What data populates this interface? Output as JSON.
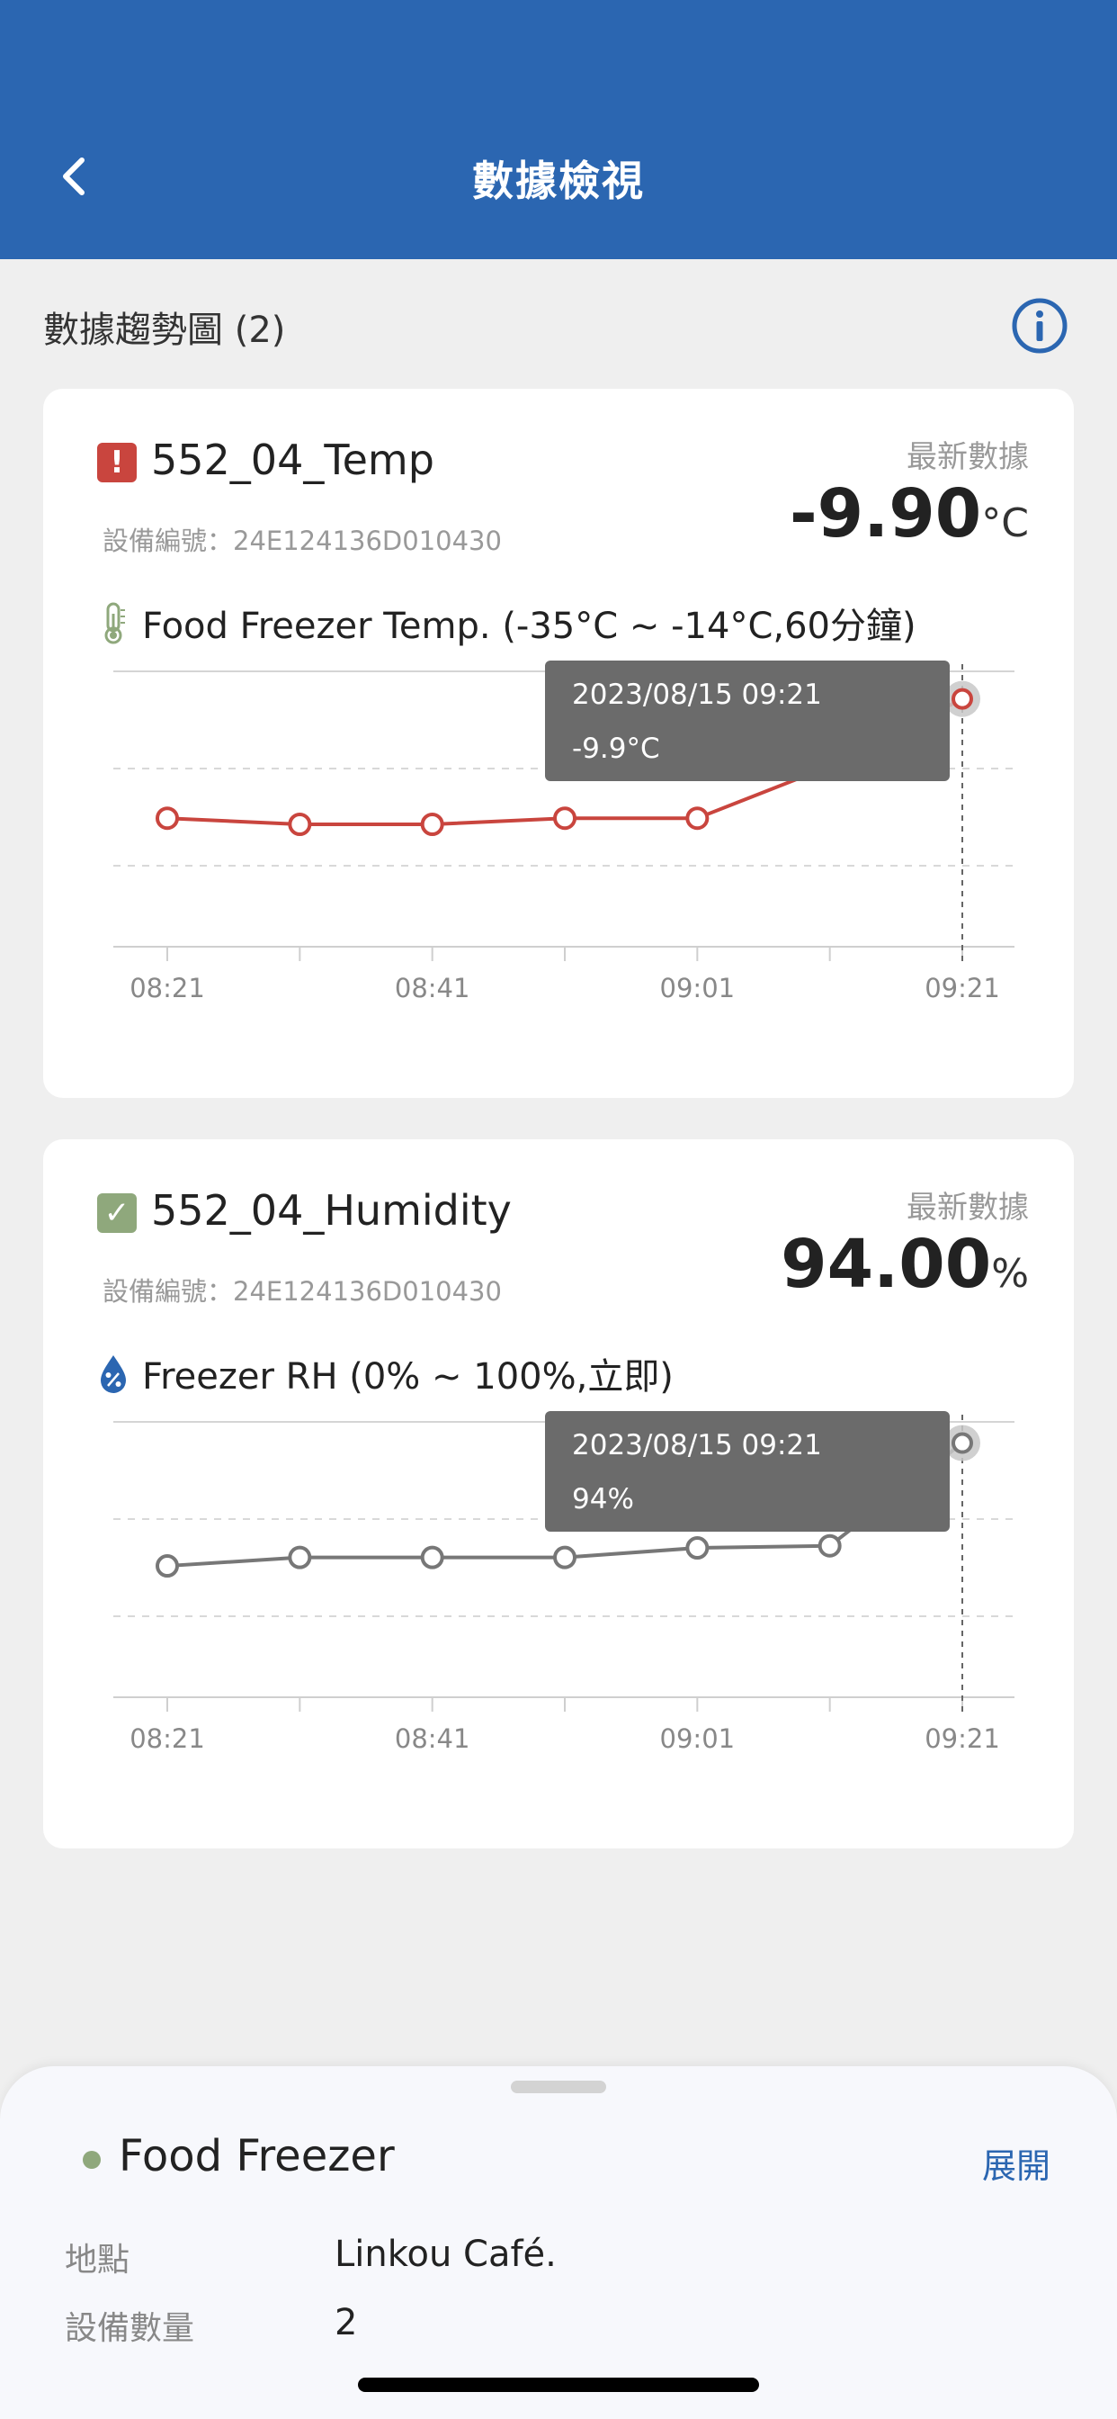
{
  "header": {
    "title": "數據檢視",
    "back_icon": "chevron-left-icon"
  },
  "section": {
    "title": "數據趨勢圖 (2)",
    "info_icon": "info-circle-icon"
  },
  "cards": [
    {
      "status": "alert",
      "status_glyph": "!",
      "sensor_name": "552_04_Temp",
      "device_id": "設備編號：24E124136D010430",
      "latest_label": "最新數據",
      "latest_value": "-9.90",
      "latest_unit": "°C",
      "metric_label": "Food Freezer Temp. (-35°C ~ -14°C,60分鐘)",
      "metric_icon": "thermometer-icon",
      "tooltip": {
        "time": "2023/08/15 09:21",
        "value": "-9.9°C"
      }
    },
    {
      "status": "ok",
      "status_glyph": "✓",
      "sensor_name": "552_04_Humidity",
      "device_id": "設備編號：24E124136D010430",
      "latest_label": "最新數據",
      "latest_value": "94.00",
      "latest_unit": "%",
      "metric_label": "Freezer RH (0% ~ 100%,立即)",
      "metric_icon": "humidity-drop-icon",
      "tooltip": {
        "time": "2023/08/15 09:21",
        "value": "94%"
      }
    }
  ],
  "chart_data": [
    {
      "type": "line",
      "x": [
        "08:21",
        "08:31",
        "08:41",
        "08:51",
        "09:01",
        "09:11",
        "09:21"
      ],
      "x_tick_labels": [
        "08:21",
        "08:41",
        "09:01",
        "09:21"
      ],
      "values": [
        -13.8,
        -14.0,
        -14.0,
        -13.8,
        -13.8,
        -12.1,
        -9.9
      ],
      "ylim": [
        -18,
        -9
      ],
      "grid": true,
      "color": "#c9453e"
    },
    {
      "type": "line",
      "x": [
        "08:21",
        "08:31",
        "08:41",
        "08:51",
        "09:01",
        "09:11",
        "09:21"
      ],
      "x_tick_labels": [
        "08:21",
        "08:41",
        "09:01",
        "09:21"
      ],
      "values": [
        82.4,
        83.2,
        83.2,
        83.2,
        84.1,
        84.3,
        94.0
      ],
      "ylim": [
        70,
        96
      ],
      "grid": true,
      "color": "#777777"
    }
  ],
  "sheet": {
    "site_name": "Food Freezer",
    "status_color": "#8fa87c",
    "expand_label": "展開",
    "rows": [
      {
        "label": "地點",
        "value": "Linkou Café."
      },
      {
        "label": "設備數量",
        "value": "2"
      }
    ]
  }
}
